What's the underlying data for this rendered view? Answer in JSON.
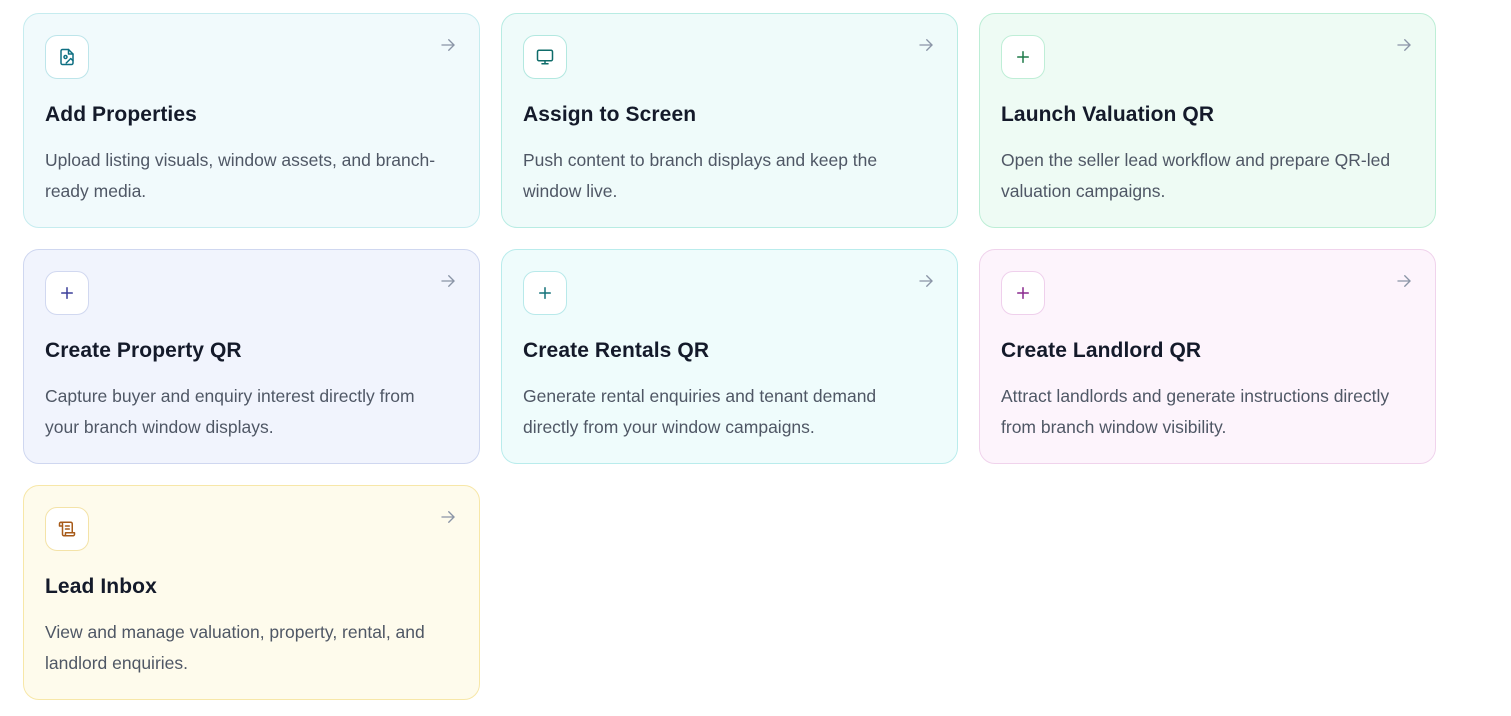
{
  "cards": [
    {
      "title": "Add Properties",
      "description": "Upload listing visuals, window assets, and branch-ready media.",
      "icon": "file-image-icon",
      "bg": "#f1fafc",
      "border": "#c6ecef",
      "icon_color": "#0e6f82",
      "icon_border": "#bde5ea"
    },
    {
      "title": "Assign to Screen",
      "description": "Push content to branch displays and keep the window live.",
      "icon": "monitor-icon",
      "bg": "#effbfa",
      "border": "#b8ece3",
      "icon_color": "#0f6c6a",
      "icon_border": "#b3e8e0"
    },
    {
      "title": "Launch Valuation QR",
      "description": "Open the seller lead workflow and prepare QR-led valuation campaigns.",
      "icon": "plus-icon",
      "bg": "#eefbf4",
      "border": "#bdeed6",
      "icon_color": "#1f7a48",
      "icon_border": "#bfeed7"
    },
    {
      "title": "Create Property QR",
      "description": "Capture buyer and enquiry interest directly from your branch window displays.",
      "icon": "plus-icon",
      "bg": "#f1f4fd",
      "border": "#cfd7f0",
      "icon_color": "#3b3f9a",
      "icon_border": "#d1d8f0"
    },
    {
      "title": "Create Rentals QR",
      "description": "Generate rental enquiries and tenant demand directly from your window campaigns.",
      "icon": "plus-icon",
      "bg": "#effcfc",
      "border": "#b9ecec",
      "icon_color": "#14727a",
      "icon_border": "#b8e9ea"
    },
    {
      "title": "Create Landlord QR",
      "description": "Attract landlords and generate instructions directly from branch window visibility.",
      "icon": "plus-icon",
      "bg": "#fdf4fc",
      "border": "#f0d3ec",
      "icon_color": "#8a2a8e",
      "icon_border": "#efd0ec"
    },
    {
      "title": "Lead Inbox",
      "description": "View and manage valuation, property, rental, and landlord enquiries.",
      "icon": "scroll-icon",
      "bg": "#fefbec",
      "border": "#f7e7a8",
      "icon_color": "#a75a18",
      "icon_border": "#f4e3a8"
    }
  ],
  "arrow_icon": "arrow-right-icon",
  "arrow_color": "#8a94a6"
}
